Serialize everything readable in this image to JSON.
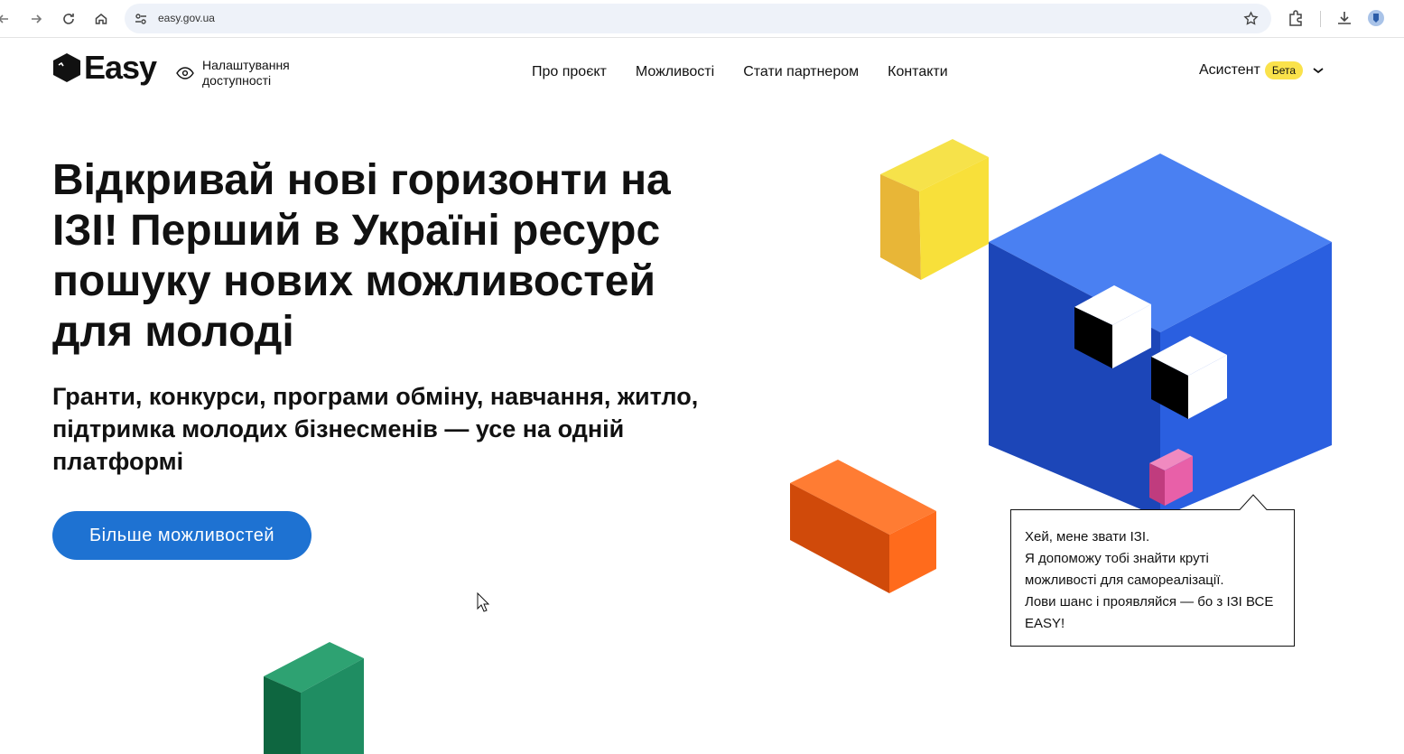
{
  "browser": {
    "url": "easy.gov.ua"
  },
  "header": {
    "logo_text": "Easy",
    "accessibility_label": "Налаштування доступності",
    "nav": [
      {
        "label": "Про проєкт"
      },
      {
        "label": "Можливості"
      },
      {
        "label": "Стати партнером"
      },
      {
        "label": "Контакти"
      }
    ],
    "assistant_label": "Асистент",
    "assistant_badge": "Бета"
  },
  "hero": {
    "title": "Відкривай нові горизонти на ІЗІ! Перший в Україні ресурс пошуку нових можливостей для молоді",
    "subtitle": "Гранти, конкурси, програми обміну, навчання, житло, підтримка молодих бізнесменів — усе на одній платформі",
    "cta_label": "Більше можливостей"
  },
  "bubble": {
    "lines": [
      "Хей, мене звати ІЗІ.",
      "Я допоможу тобі знайти круті можливості для самореалізації.",
      "Лови шанс і проявляйся — бо з ІЗІ ВСЕ EASY!"
    ]
  },
  "colors": {
    "primary_blue": "#1e72d2",
    "cube_blue": "#4a7ff0",
    "yellow": "#f8e03a",
    "orange": "#ff6b1c",
    "green": "#1f8d62",
    "pink": "#e860a8",
    "beta_badge": "#fae24b"
  }
}
